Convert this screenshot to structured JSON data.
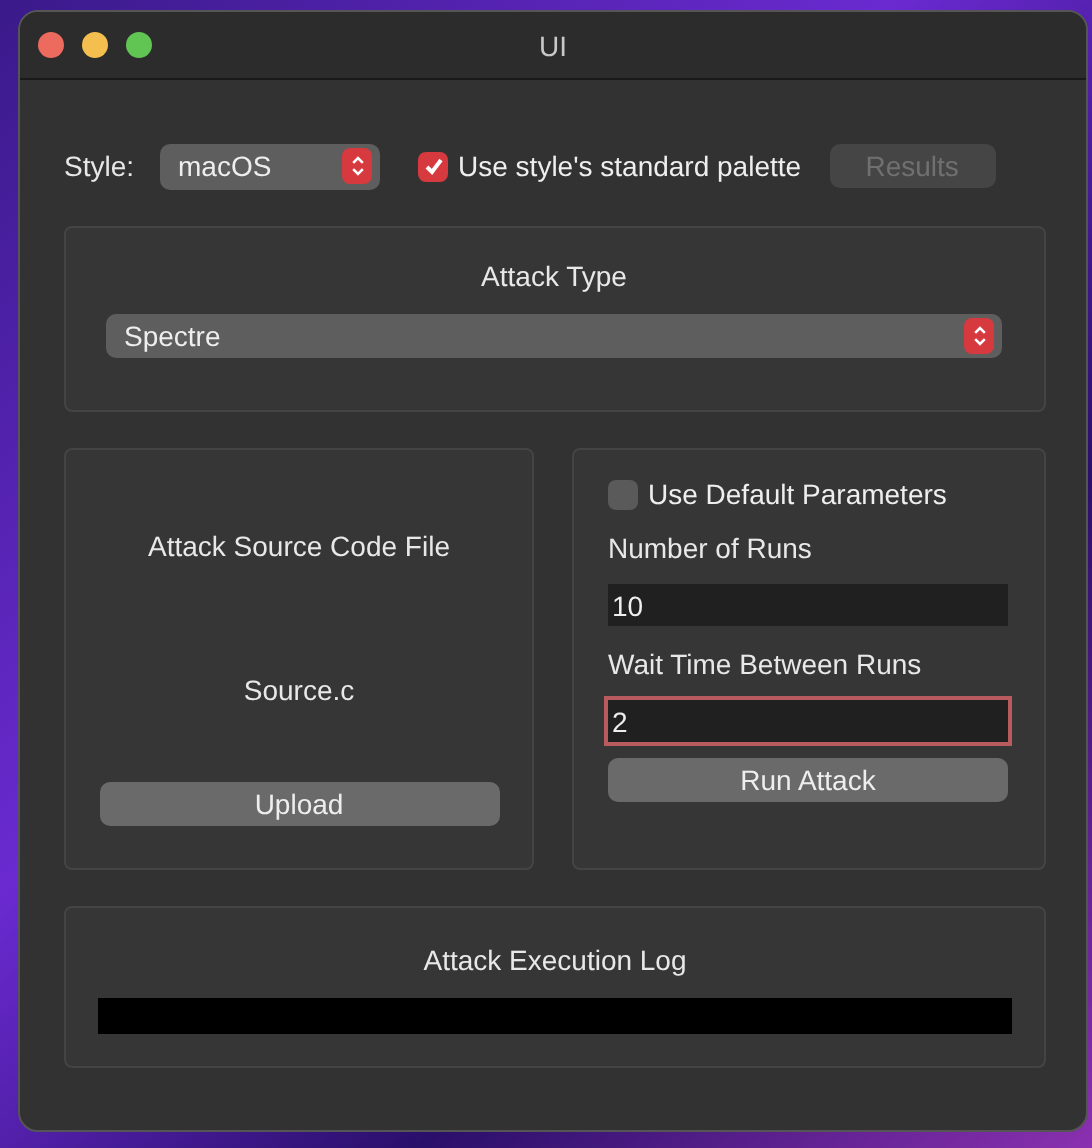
{
  "window": {
    "title": "UI"
  },
  "toolbar": {
    "style_label": "Style:",
    "style_value": "macOS",
    "palette_checkbox": {
      "label": "Use style's standard palette",
      "checked": true
    },
    "results_button": {
      "label": "Results",
      "disabled": true
    }
  },
  "attack_type": {
    "title": "Attack Type",
    "value": "Spectre"
  },
  "source_panel": {
    "title": "Attack Source Code File",
    "file_name": "Source.c",
    "button": "Upload"
  },
  "params_panel": {
    "default_checkbox": {
      "label": "Use Default Parameters",
      "checked": false
    },
    "fields": [
      {
        "label": "Number of Runs",
        "value": "10",
        "focused": false
      },
      {
        "label": "Wait Time Between Runs",
        "value": "2",
        "focused": true
      }
    ],
    "button": "Run Attack"
  },
  "log_panel": {
    "title": "Attack Execution Log"
  }
}
